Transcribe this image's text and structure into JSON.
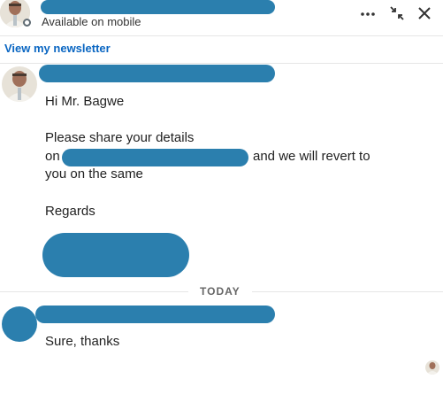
{
  "header": {
    "status": "Available on mobile",
    "icons": [
      "more-icon",
      "minimize-icon",
      "close-icon"
    ]
  },
  "newsletter_link": "View my newsletter",
  "conversation": {
    "message1": {
      "greeting": "Hi Mr. Bagwe",
      "line1": "Please share your details",
      "line2_prefix": "on",
      "line2_suffix": "and we will revert to",
      "line3": "you on the same",
      "closing": "Regards"
    },
    "date_divider": "TODAY",
    "message2": {
      "text": "Sure, thanks"
    }
  },
  "colors": {
    "redaction": "#2b7fae",
    "link": "#0a66c2"
  }
}
